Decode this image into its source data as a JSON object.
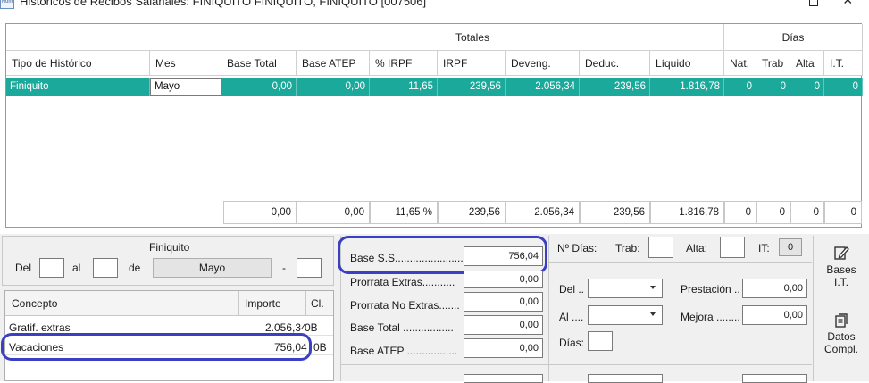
{
  "window": {
    "title": "Históricos de Recibos Salariales: FINIQUITO FINIQUITO, FINIQUITO [007506]",
    "icon_text": "Nom"
  },
  "grid": {
    "group_totales": "Totales",
    "group_dias": "Días",
    "columns": [
      "Tipo de Histórico",
      "Mes",
      "Base Total",
      "Base ATEP",
      "% IRPF",
      "IRPF",
      "Deveng.",
      "Deduc.",
      "Líquido",
      "Nat.",
      "Trab",
      "Alta",
      "I.T."
    ],
    "row": [
      "Finiquito",
      "Mayo",
      "0,00",
      "0,00",
      "11,65",
      "239,56",
      "2.056,34",
      "239,56",
      "1.816,78",
      "0",
      "0",
      "0",
      "0"
    ],
    "totals": [
      "0,00",
      "0,00",
      "11,65 %",
      "239,56",
      "2.056,34",
      "239,56",
      "1.816,78",
      "0",
      "0",
      "0",
      "0"
    ],
    "selected_row_color": "#1aa99a"
  },
  "finiquito": {
    "title": "Finiquito",
    "del_label": "Del",
    "al_label": "al",
    "de_label": "de",
    "mes_value": "Mayo",
    "dash": "-"
  },
  "conceptos": {
    "headers": [
      "Concepto",
      "Importe",
      "Cl."
    ],
    "rows": [
      {
        "concepto": "Gratif. extras",
        "importe": "2.056,34",
        "cl": "0B"
      },
      {
        "concepto": "Vacaciones",
        "importe": "756,04",
        "cl": "0B"
      }
    ]
  },
  "bases": {
    "base_ss_label": "Base S.S.........................",
    "base_ss_value": "756,04",
    "prorrata_extras_label": "Prorrata Extras...........",
    "prorrata_extras_value": "0,00",
    "prorrata_no_extras_label": "Prorrata No Extras.......",
    "prorrata_no_extras_value": "0,00",
    "base_total_label": "Base Total .................",
    "base_total_value": "0,00",
    "base_atep_label": "Base ATEP .................",
    "base_atep_value": "0,00"
  },
  "dias": {
    "n_dias_label": "Nº Días:",
    "trab_label": "Trab:",
    "alta_label": "Alta:",
    "it_label": "IT:",
    "it_value": "0",
    "del_label": "Del ..",
    "al_label": "Al ....",
    "dias_label": "Días:",
    "prestacion_label": "Prestación ..",
    "prestacion_value": "0,00",
    "mejora_label": "Mejora ........",
    "mejora_value": "0,00"
  },
  "side_buttons": {
    "bases_it": [
      "Bases",
      "I.T."
    ],
    "datos_compl": [
      "Datos",
      "Compl."
    ]
  },
  "accent_color": "#3a3fc4"
}
